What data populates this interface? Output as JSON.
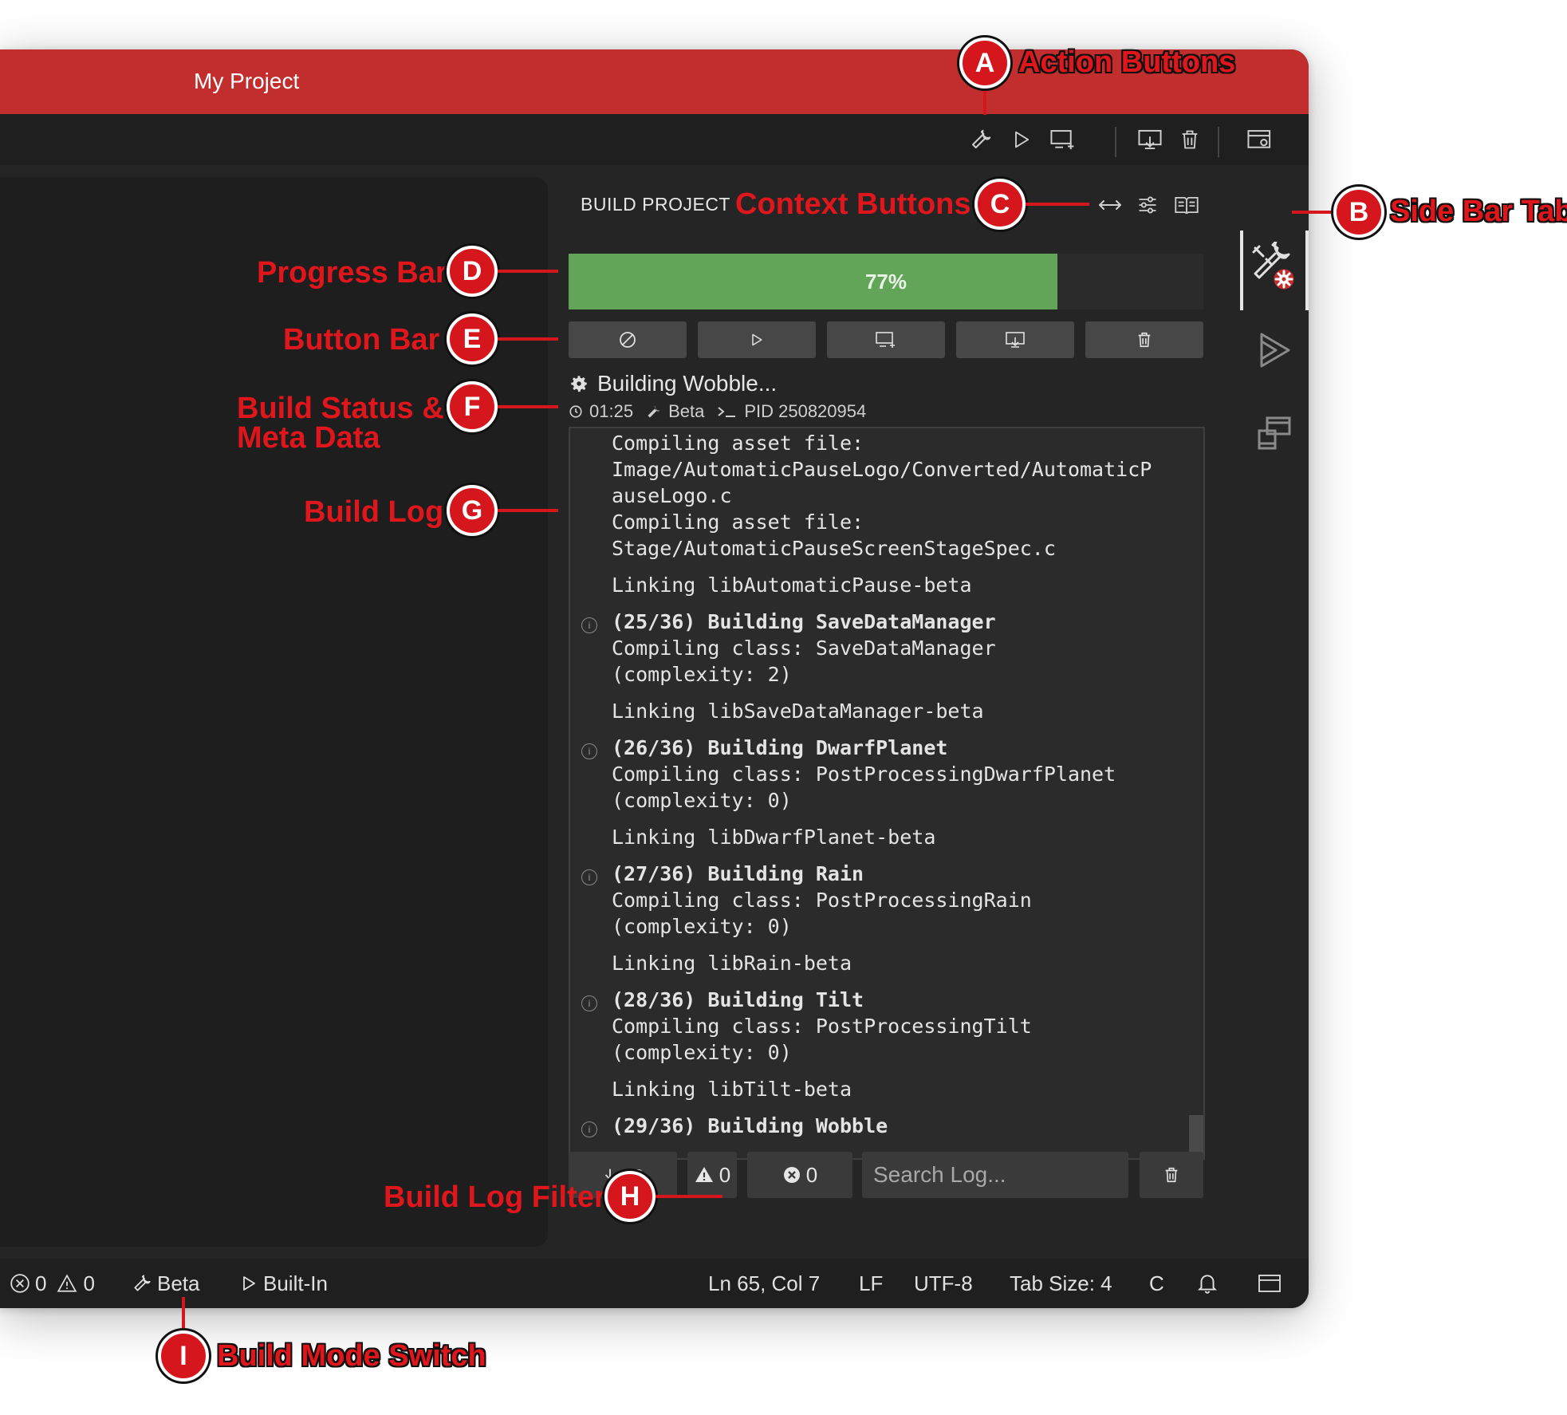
{
  "window": {
    "title": "My Project"
  },
  "action_bar": {
    "buttons": [
      {
        "icon": "wrench-icon",
        "label": "Build"
      },
      {
        "icon": "play-icon",
        "label": "Run"
      },
      {
        "icon": "add-target-icon",
        "label": "Add"
      },
      {
        "icon": "deploy-icon",
        "label": "Deploy"
      },
      {
        "icon": "trash-icon",
        "label": "Clean"
      },
      {
        "icon": "window-settings-icon",
        "label": "Settings"
      }
    ]
  },
  "sidebar": {
    "panel_title": "BUILD PROJECT",
    "context_buttons": [
      {
        "icon": "expand-horizontal-icon"
      },
      {
        "icon": "sliders-icon"
      },
      {
        "icon": "book-icon"
      }
    ],
    "progress": {
      "value": 0.77,
      "label": "77%"
    },
    "button_bar": [
      {
        "icon": "cancel-icon"
      },
      {
        "icon": "play-icon"
      },
      {
        "icon": "add-target-icon"
      },
      {
        "icon": "deploy-icon"
      },
      {
        "icon": "trash-icon"
      }
    ],
    "build_status": {
      "text": "Building Wobble...",
      "elapsed": "01:25",
      "mode": "Beta",
      "pid": "PID 250820954"
    },
    "log": [
      {
        "text": "Compiling asset file:",
        "bold": false,
        "info": false
      },
      {
        "text": "Image/AutomaticPauseLogo/Converted/AutomaticP",
        "bold": false,
        "info": false
      },
      {
        "text": "auseLogo.c",
        "bold": false,
        "info": false
      },
      {
        "text": "Compiling asset file:",
        "bold": false,
        "info": false
      },
      {
        "text": "Stage/AutomaticPauseScreenStageSpec.c",
        "bold": false,
        "info": false
      },
      {
        "text": "Linking libAutomaticPause-beta",
        "bold": false,
        "info": false
      },
      {
        "text": "(25/36) Building SaveDataManager",
        "bold": true,
        "info": true
      },
      {
        "text": "Compiling class: SaveDataManager",
        "bold": false,
        "info": false
      },
      {
        "text": "(complexity: 2)",
        "bold": false,
        "info": false
      },
      {
        "text": "Linking libSaveDataManager-beta",
        "bold": false,
        "info": false
      },
      {
        "text": "(26/36) Building DwarfPlanet",
        "bold": true,
        "info": true
      },
      {
        "text": "Compiling class: PostProcessingDwarfPlanet",
        "bold": false,
        "info": false
      },
      {
        "text": "(complexity: 0)",
        "bold": false,
        "info": false
      },
      {
        "text": "Linking libDwarfPlanet-beta",
        "bold": false,
        "info": false
      },
      {
        "text": "(27/36) Building Rain",
        "bold": true,
        "info": true
      },
      {
        "text": "Compiling class: PostProcessingRain",
        "bold": false,
        "info": false
      },
      {
        "text": "(complexity: 0)",
        "bold": false,
        "info": false
      },
      {
        "text": "Linking libRain-beta",
        "bold": false,
        "info": false
      },
      {
        "text": "(28/36) Building Tilt",
        "bold": true,
        "info": true
      },
      {
        "text": "Compiling class: PostProcessingTilt",
        "bold": false,
        "info": false
      },
      {
        "text": "(complexity: 0)",
        "bold": false,
        "info": false
      },
      {
        "text": "Linking libTilt-beta",
        "bold": false,
        "info": false
      },
      {
        "text": "(29/36) Building Wobble",
        "bold": true,
        "info": true
      }
    ],
    "filter": {
      "warnings": "0",
      "errors": "0",
      "search_placeholder": "Search Log...",
      "search_value": ""
    }
  },
  "activity_bar": [
    {
      "icon": "build-tools-icon",
      "active": true
    },
    {
      "icon": "run-icon",
      "active": false
    },
    {
      "icon": "devices-icon",
      "active": false
    }
  ],
  "status_bar": {
    "errors": "0",
    "warnings": "0",
    "build_mode": "Beta",
    "emulator": "Built-In",
    "cursor": "Ln 65, Col 7",
    "eol": "LF",
    "encoding": "UTF-8",
    "tab_size": "Tab Size: 4",
    "language": "C"
  },
  "annotations": [
    {
      "letter": "A",
      "label": "Action Buttons"
    },
    {
      "letter": "B",
      "label": "Side Bar Tab"
    },
    {
      "letter": "C",
      "label": "Context Buttons"
    },
    {
      "letter": "D",
      "label": "Progress Bar"
    },
    {
      "letter": "E",
      "label": "Button Bar"
    },
    {
      "letter": "F",
      "label": "Build Status &",
      "label2": "Meta Data"
    },
    {
      "letter": "G",
      "label": "Build Log"
    },
    {
      "letter": "H",
      "label": "Build Log Filter"
    },
    {
      "letter": "I",
      "label": "Build Mode Switch"
    }
  ],
  "colors": {
    "title_bar": "#c22e2e",
    "progress_fill": "#62a558",
    "annotation_red": "#d6161d"
  }
}
